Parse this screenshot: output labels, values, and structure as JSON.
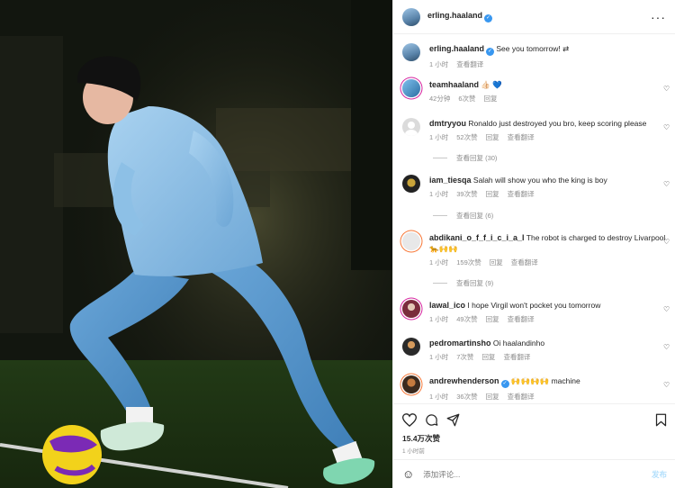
{
  "header": {
    "username": "erling.haaland",
    "more": "···"
  },
  "caption": {
    "username": "erling.haaland",
    "text": "See you tomorrow! ⇄",
    "time": "1 小时",
    "translate": "查看翻译"
  },
  "comments": [
    {
      "username": "teamhaaland",
      "text": "👍🏻 💙",
      "time": "42分钟",
      "likes": "6次赞",
      "reply": "回复",
      "translate": "",
      "replies": ""
    },
    {
      "username": "dmtryyou",
      "text": "Ronaldo just destroyed you bro, keep scoring please",
      "time": "1 小时",
      "likes": "52次赞",
      "reply": "回复",
      "translate": "查看翻译",
      "replies": "查看回复 (30)"
    },
    {
      "username": "iam_tiesqa",
      "text": "Salah will show you who the king is boy",
      "time": "1 小时",
      "likes": "39次赞",
      "reply": "回复",
      "translate": "查看翻译",
      "replies": "查看回复 (6)"
    },
    {
      "username": "abdikani_o_f_f_i_c_i_a_l",
      "text": "The robot is charged to destroy Livarpool 🐆🙌🙌",
      "time": "1 小时",
      "likes": "159次赞",
      "reply": "回复",
      "translate": "查看翻译",
      "replies": "查看回复 (9)"
    },
    {
      "username": "lawal_ico",
      "text": "I hope Virgil won't pocket you tomorrow",
      "time": "1 小时",
      "likes": "49次赞",
      "reply": "回复",
      "translate": "查看翻译",
      "replies": ""
    },
    {
      "username": "pedromartinsho",
      "text": "Oi haalandinho",
      "time": "1 小时",
      "likes": "7次赞",
      "reply": "回复",
      "translate": "查看翻译",
      "replies": ""
    },
    {
      "username": "andrewhenderson",
      "text": "🙌🙌🙌🙌 machine",
      "time": "1 小时",
      "likes": "36次赞",
      "reply": "回复",
      "translate": "查看翻译",
      "replies": ""
    }
  ],
  "footer": {
    "likes": "15.4万次赞",
    "time": "1 小时前"
  },
  "add_comment": {
    "placeholder": "添加评论...",
    "post": "发布"
  },
  "colors": {
    "accent": "#3897f0",
    "kit": "#7fb6e2"
  }
}
